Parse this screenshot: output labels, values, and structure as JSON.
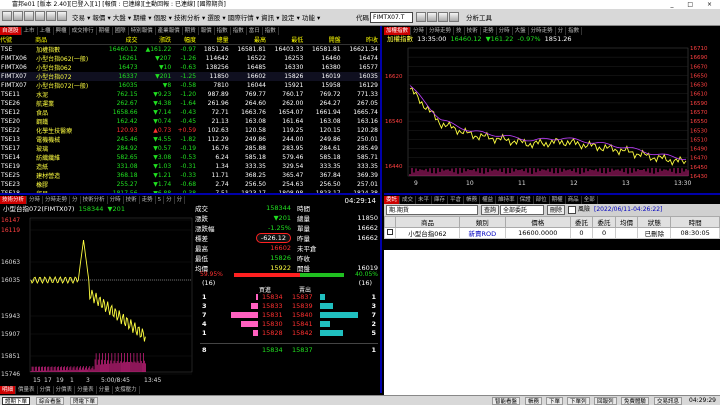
{
  "window": {
    "title": "富邦e01 [版本 2.40][已登入][1] [報價 : 已連線][主動回報 : 已連線] [國際期貨]",
    "controls": "_ □ ×"
  },
  "toolbar": {
    "menu": "交易 ▾ 報價 ▾ 大盤 ▾ 期權 ▾ 個股 ▾ 技術分析 ▾ 選股 ▾ 國際行情 ▾ 資訊 ▾ 設定 ▾ 功能 ▾",
    "code_value": "FIMTX07.T",
    "code_label": "代碼",
    "right_label": "分析工具"
  },
  "quote_panel": {
    "tabs": [
      "自選股",
      "上市",
      "上櫃",
      "興櫃",
      "成交排行",
      "期權",
      "國際",
      "特別報價",
      "產業報價",
      "期貨",
      "報價",
      "指數",
      "指數",
      "當日",
      "指數"
    ],
    "right_tabs": "盤後 成交 報告",
    "headers": [
      "代號",
      "商品",
      "成交",
      "漲跌",
      "幅度",
      "總量",
      "最高",
      "最低",
      "開盤",
      "昨收"
    ],
    "rows": [
      {
        "code": "TSE",
        "name": "加權指數",
        "price": "16460.12",
        "chg": "▲161.22",
        "pct": "-0.97",
        "vol": "1851.26",
        "high": "16581.81",
        "low": "16403.33",
        "open": "16581.81",
        "prev": "16621.34",
        "c": "grn"
      },
      {
        "code": "FIMTX06",
        "name": "小型台指062(一般)",
        "price": "16261",
        "chg": "▼207",
        "pct": "-1.26",
        "vol": "114642",
        "high": "16522",
        "low": "16253",
        "open": "16460",
        "prev": "16474",
        "c": "grn"
      },
      {
        "code": "FIMTX06",
        "name": "小型台指062",
        "price": "16473",
        "chg": "▼10",
        "pct": "-0.63",
        "vol": "138256",
        "high": "16485",
        "low": "16330",
        "open": "16380",
        "prev": "16577",
        "c": "grn"
      },
      {
        "code": "FIMTX07",
        "name": "小型台指072",
        "price": "16337",
        "chg": "▼201",
        "pct": "-1.25",
        "vol": "11850",
        "high": "16602",
        "low": "15826",
        "open": "16019",
        "prev": "16035",
        "c": "grn"
      },
      {
        "code": "FIMTX07",
        "name": "小型台指072(一般)",
        "price": "16035",
        "chg": "▼8",
        "pct": "-0.58",
        "vol": "7810",
        "high": "16044",
        "low": "15921",
        "open": "15958",
        "prev": "16129",
        "c": "grn"
      },
      {
        "code": "TSE11",
        "name": "水泥",
        "price": "762.15",
        "chg": "▼9.23",
        "pct": "-1.20",
        "vol": "987.89",
        "high": "769.77",
        "low": "760.17",
        "open": "769.72",
        "prev": "771.33",
        "c": "grn"
      },
      {
        "code": "TSE26",
        "name": "航運業",
        "price": "262.67",
        "chg": "▼4.38",
        "pct": "-1.64",
        "vol": "261.96",
        "high": "264.60",
        "low": "262.00",
        "open": "264.27",
        "prev": "267.05",
        "c": "grn"
      },
      {
        "code": "TSE12",
        "name": "食品",
        "price": "1658.66",
        "chg": "▼7.14",
        "pct": "-0.43",
        "vol": "72.71",
        "high": "1663.76",
        "low": "1654.07",
        "open": "1661.94",
        "prev": "1665.74",
        "c": "grn"
      },
      {
        "code": "TSE20",
        "name": "鋼鐵",
        "price": "162.42",
        "chg": "▼0.74",
        "pct": "-0.45",
        "vol": "21.13",
        "high": "163.08",
        "low": "161.64",
        "open": "163.08",
        "prev": "163.16",
        "c": "grn"
      },
      {
        "code": "TSE22",
        "name": "化學生技醫療",
        "price": "120.93",
        "chg": "▲0.73",
        "pct": "+0.59",
        "vol": "102.63",
        "high": "120.58",
        "low": "119.25",
        "open": "120.15",
        "prev": "120.28",
        "c": "red"
      },
      {
        "code": "TSE13",
        "name": "電機機械",
        "price": "245.46",
        "chg": "▼4.55",
        "pct": "-1.82",
        "vol": "112.29",
        "high": "249.86",
        "low": "244.00",
        "open": "249.86",
        "prev": "250.01",
        "c": "grn"
      },
      {
        "code": "TSE17",
        "name": "玻璃",
        "price": "284.92",
        "chg": "▼0.57",
        "pct": "-0.19",
        "vol": "16.76",
        "high": "285.88",
        "low": "283.95",
        "open": "284.61",
        "prev": "285.49",
        "c": "grn"
      },
      {
        "code": "TSE14",
        "name": "紡織纖維",
        "price": "582.65",
        "chg": "▼3.08",
        "pct": "-0.53",
        "vol": "6.24",
        "high": "585.18",
        "low": "579.46",
        "open": "585.18",
        "prev": "585.71",
        "c": "grn"
      },
      {
        "code": "TSE19",
        "name": "造紙",
        "price": "331.08",
        "chg": "▼1.03",
        "pct": "-0.31",
        "vol": "1.34",
        "high": "333.35",
        "low": "329.54",
        "open": "333.35",
        "prev": "333.35",
        "c": "grn"
      },
      {
        "code": "TSE25",
        "name": "建材營造",
        "price": "368.18",
        "chg": "▼1.21",
        "pct": "-0.33",
        "vol": "11.71",
        "high": "368.25",
        "low": "365.47",
        "open": "367.84",
        "prev": "369.39",
        "c": "grn"
      },
      {
        "code": "TSE23",
        "name": "橡膠",
        "price": "255.27",
        "chg": "▼1.74",
        "pct": "-0.68",
        "vol": "2.74",
        "high": "256.50",
        "low": "254.63",
        "open": "256.50",
        "prev": "257.01",
        "c": "grn"
      },
      {
        "code": "TSE18",
        "name": "貿易",
        "price": "1817.56",
        "chg": "▼6.88",
        "pct": "-0.38",
        "vol": "7.51",
        "high": "1823.17",
        "low": "1808.98",
        "open": "1823.17",
        "prev": "1824.38",
        "c": "grn"
      },
      {
        "code": "TSE21",
        "name": "汽車",
        "price": "333.35",
        "chg": "▲0.88",
        "pct": "+0.34",
        "vol": "31.12",
        "high": "331.22",
        "low": "326.76",
        "open": "330.65",
        "prev": "330.93",
        "c": "red"
      }
    ]
  },
  "index_panel": {
    "tabs": [
      "加權指數",
      "分時",
      "分時走勢",
      "技",
      "技術",
      "走勢",
      "分時",
      "大盤",
      "分時走勢",
      "分",
      "指數"
    ],
    "name": "加權指數",
    "time": "13:35:00",
    "price": "16460.12",
    "chg": "▼161.22",
    "pct": "-0.97%",
    "vol": "1851.26",
    "y_ticks": [
      "16710",
      "16690",
      "16670",
      "16650",
      "16630",
      "16610",
      "16590",
      "16570",
      "16550",
      "16530",
      "16510",
      "16490",
      "16470",
      "16450",
      "16430"
    ],
    "y_ticks_left": [
      "16620",
      "16540",
      "16440"
    ],
    "x_ticks": [
      "9",
      "10",
      "11",
      "12",
      "13",
      "13:30"
    ]
  },
  "chart_data": {
    "type": "line",
    "title": "加權指數",
    "x": [
      "9:00",
      "9:30",
      "10:00",
      "10:30",
      "11:00",
      "11:30",
      "12:00",
      "12:30",
      "13:00",
      "13:30"
    ],
    "series": [
      {
        "name": "加權指數",
        "color": "#ffff40",
        "values": [
          16620,
          16545,
          16520,
          16510,
          16500,
          16505,
          16495,
          16485,
          16470,
          16460
        ]
      }
    ],
    "ylim": [
      16430,
      16710
    ]
  },
  "futures_chart": {
    "tabs": [
      "技術分析",
      "分時",
      "分時走勢",
      "分",
      "技術分析",
      "分時",
      "技術",
      "走勢",
      "5",
      "分",
      "分"
    ],
    "title": "小型台指072(FIMTX07)",
    "price": "158344",
    "chg": "▼201",
    "y_ticks": [
      "16147",
      "16119",
      "16063",
      "16035",
      "15943",
      "15907",
      "15851",
      "15746"
    ],
    "x_ticks": [
      "15",
      "17",
      "19",
      "1",
      "3",
      "5:00/8:45",
      "13:45"
    ],
    "bottom_tabs": [
      "明細",
      "價量表",
      "分價",
      "分價表",
      "分量表",
      "分量",
      "支撐壓力"
    ]
  },
  "ticker": {
    "time": "04:29:14",
    "rows": [
      {
        "l1": "成交",
        "v1": "158344",
        "l2": "時間",
        "v2": ""
      },
      {
        "l1": "漲跌",
        "v1": "▼201",
        "l2": "總量",
        "v2": "11850"
      },
      {
        "l1": "漲跌幅",
        "v1": "-1.25%",
        "l2": "單量",
        "v2": "16662"
      },
      {
        "l1": "標差",
        "v1": "-626.12",
        "l2": "昨量",
        "v2": "16662"
      },
      {
        "l1": "最高",
        "v1": "16602",
        "l2": "未平倉",
        "v2": ""
      },
      {
        "l1": "最低",
        "v1": "15826",
        "l2": "昨收",
        "v2": ""
      },
      {
        "l1": "均價",
        "v1": "15922",
        "l2": "開盤",
        "v2": "16019"
      }
    ],
    "ratio_left": "59.95%",
    "ratio_right": "40.05%",
    "depth_count_left": "(16)",
    "depth_count_right": "(16)",
    "depth_header_bid": "買進",
    "depth_header_ask": "賣出",
    "depth": [
      {
        "bq": "1",
        "bp": "15834",
        "ap": "15837",
        "aq": "1"
      },
      {
        "bq": "3",
        "bp": "15833",
        "ap": "15839",
        "aq": "3"
      },
      {
        "bq": "7",
        "bp": "15831",
        "ap": "15840",
        "aq": "7"
      },
      {
        "bq": "4",
        "bp": "15830",
        "ap": "15841",
        "aq": "2"
      },
      {
        "bq": "1",
        "bp": "15828",
        "ap": "15842",
        "aq": "5"
      }
    ],
    "depth_bid_fill": [
      0.05,
      0.15,
      0.55,
      0.35,
      0.1
    ],
    "depth_ask_fill": [
      0.1,
      0.25,
      0.75,
      0.2,
      0.45
    ],
    "footer": {
      "bq": "8",
      "bp": "15834",
      "ap": "15837",
      "aq": "1"
    }
  },
  "orders_panel": {
    "tabs": [
      "委託",
      "成交",
      "未平",
      "庫存",
      "平倉",
      "帳務",
      "權益",
      "維持率",
      "保證",
      "部位",
      "期權",
      "商品",
      "全部"
    ],
    "account": "期.期貨",
    "query_btn": "查詢",
    "filter": "全部委託",
    "delete_btn": "刪除",
    "risk_label": "風險",
    "date": "[2022/06/11-04:26:22]",
    "headers": [
      "",
      "商品",
      "類別",
      "價格",
      "委託",
      "委託",
      "均價",
      "狀態",
      "時間"
    ],
    "row": [
      "",
      "小型台指062",
      "新賣ROD",
      "16600.0000",
      "0",
      "0",
      "",
      "已刪除",
      "08:30:05"
    ]
  },
  "statusbar": {
    "buttons": [
      "證期下單",
      "綜合看盤",
      "閃電下單"
    ],
    "right_buttons": [
      "智能看盤",
      "帳務",
      "下單",
      "下單列",
      "回報列",
      "免費體驗",
      "交易訊息"
    ],
    "clock": "04:29:29"
  }
}
